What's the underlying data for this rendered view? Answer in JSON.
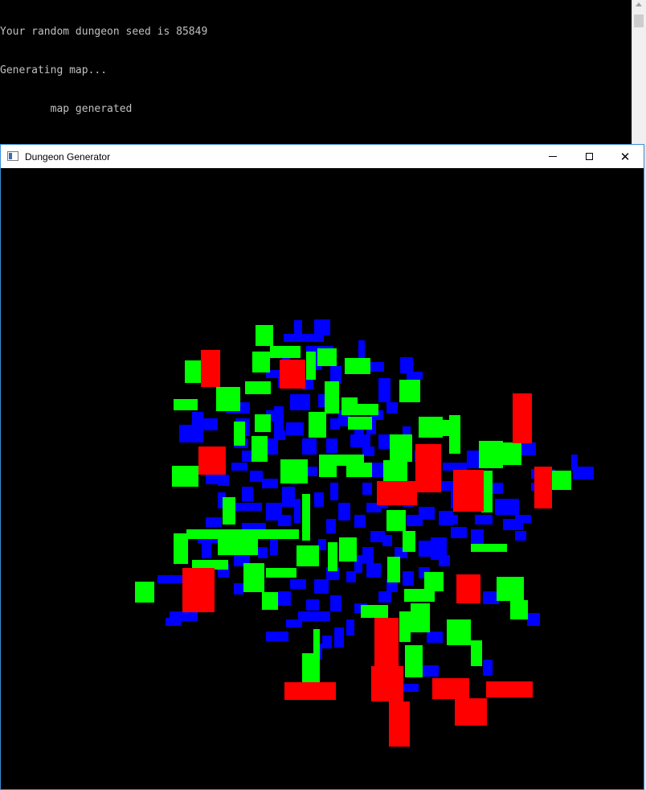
{
  "console": {
    "lines": [
      "Your random dungeon seed is 85849",
      "Generating map...",
      "        map generated"
    ]
  },
  "window": {
    "title": "Dungeon Generator",
    "icon": "app-window-icon",
    "controls": {
      "minimize_icon": "minimize-icon",
      "maximize_icon": "maximize-icon",
      "close_icon": "close-icon",
      "close_glyph": "✕"
    }
  },
  "map": {
    "colors": {
      "room_blue": "#0000ff",
      "room_green": "#00ff00",
      "room_red": "#ff0000",
      "background": "#000000"
    },
    "seed": "85849"
  }
}
